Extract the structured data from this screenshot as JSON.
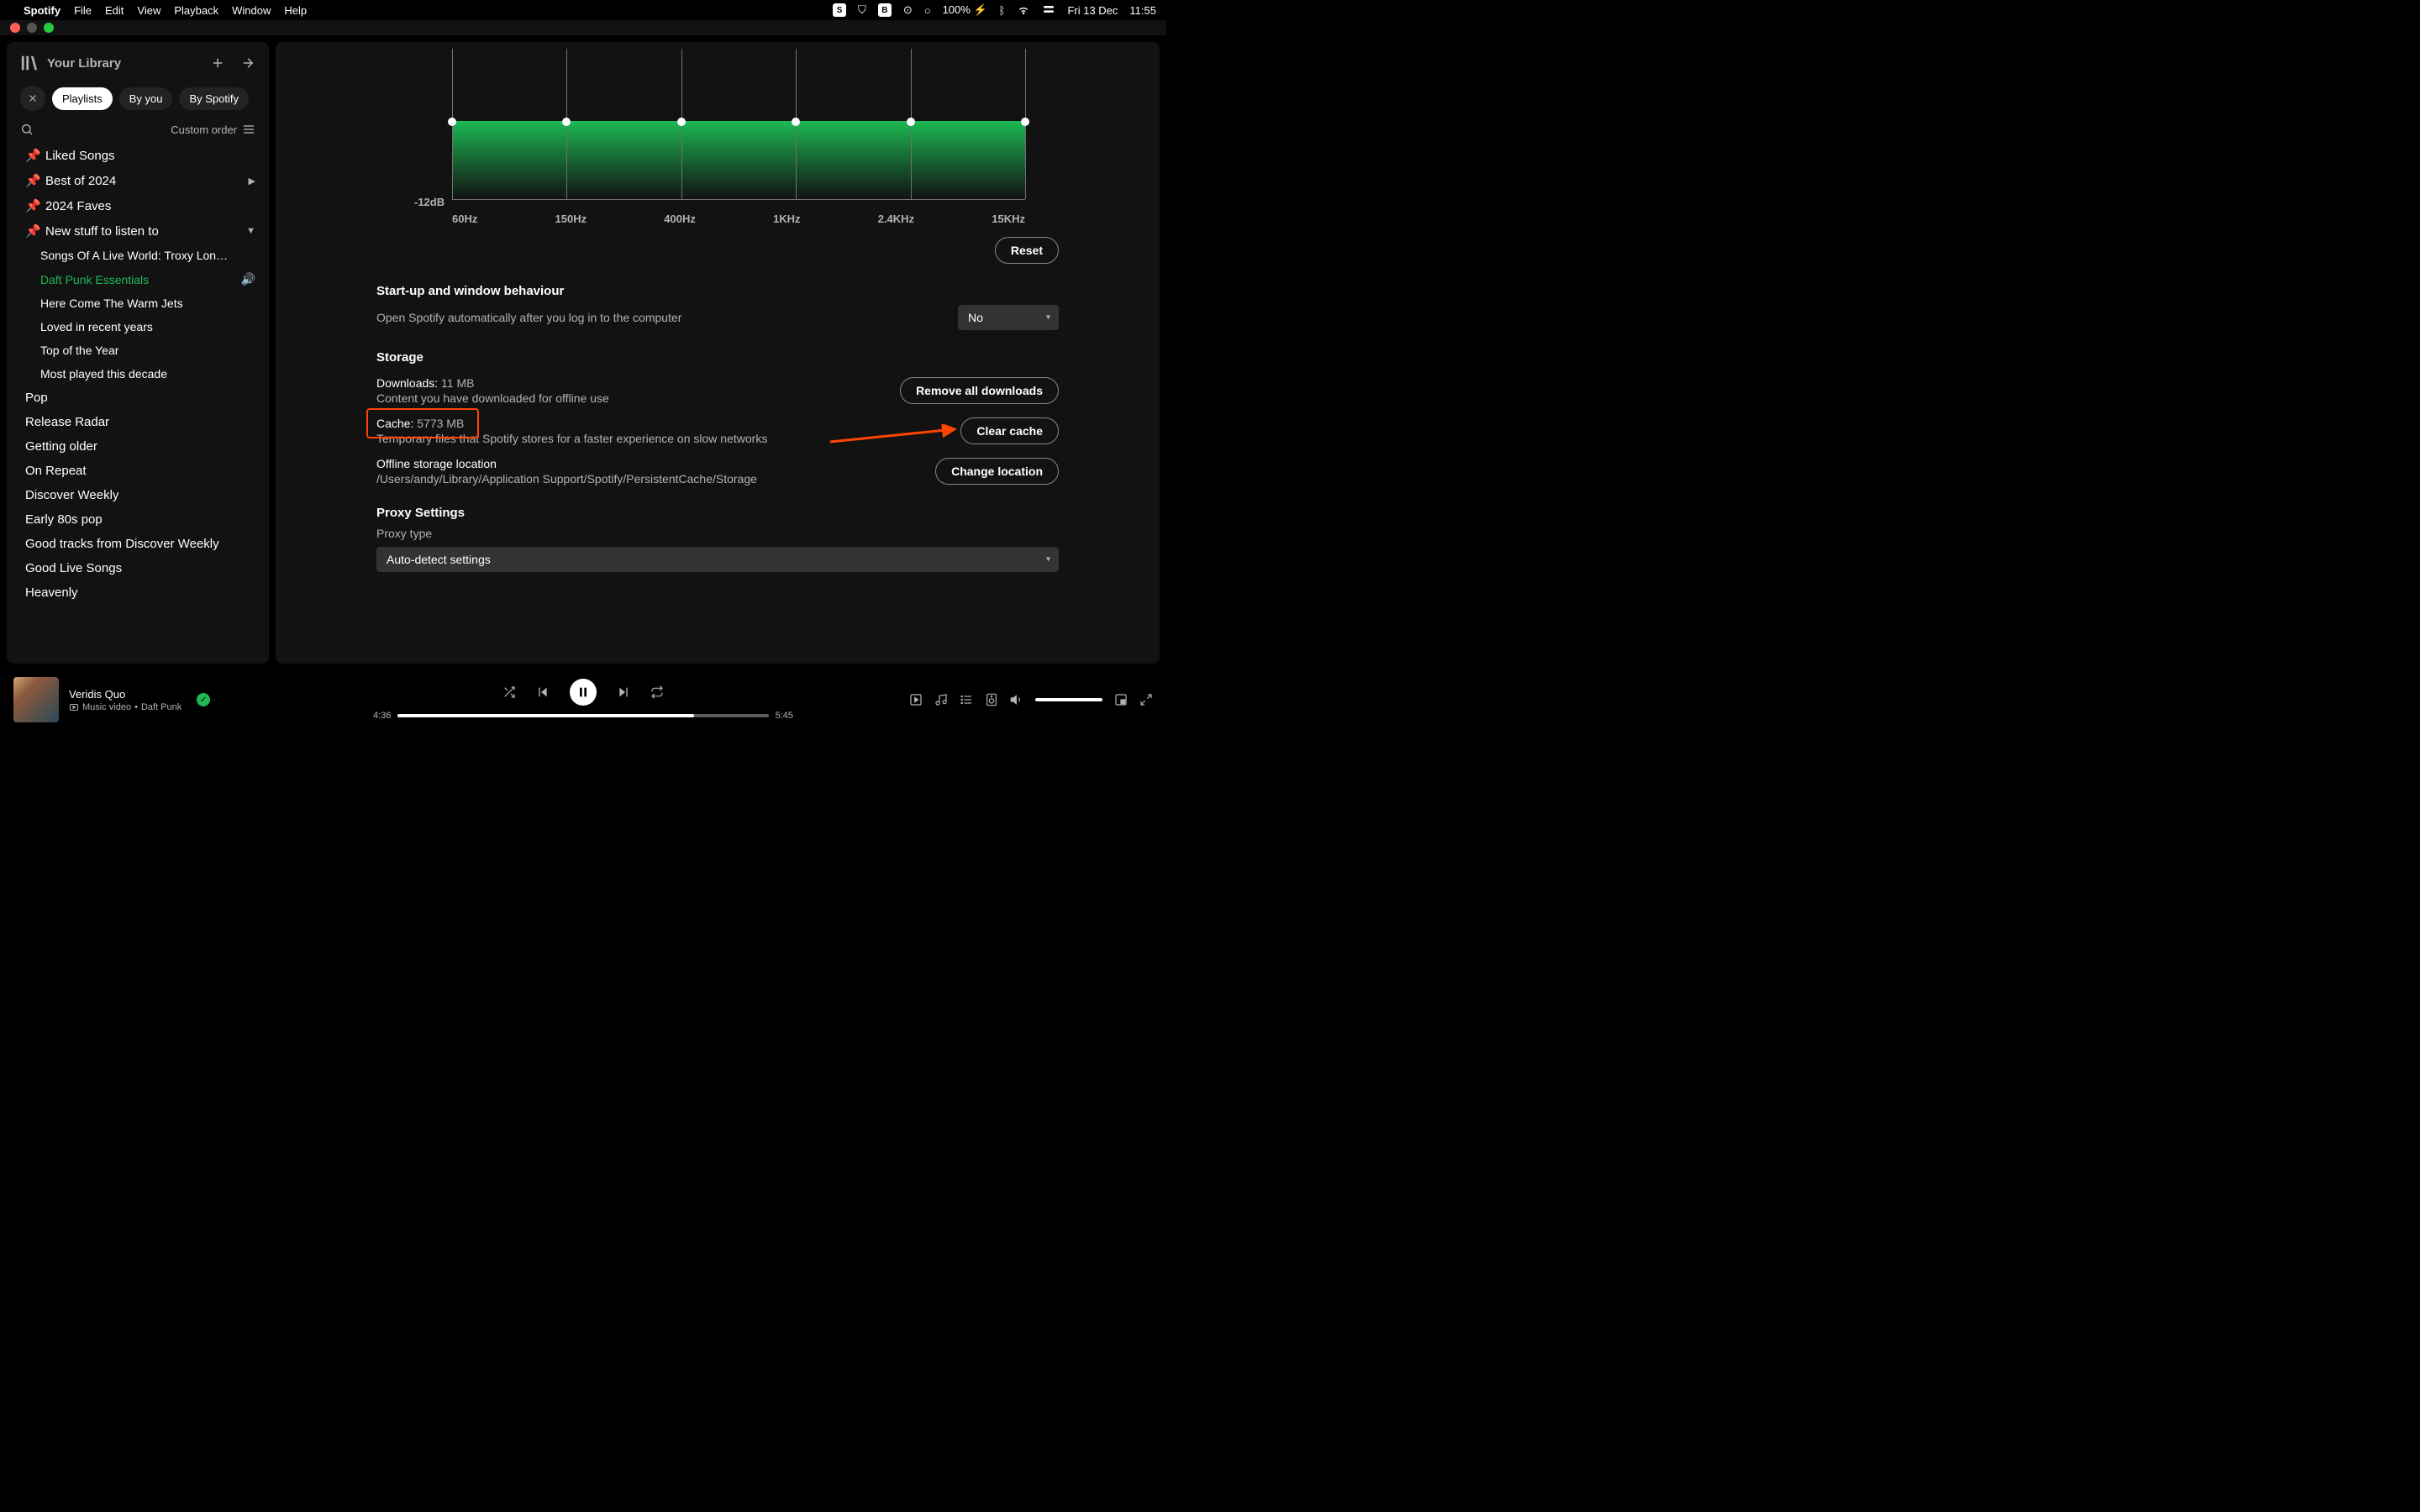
{
  "menubar": {
    "app": "Spotify",
    "items": [
      "File",
      "Edit",
      "View",
      "Playback",
      "Window",
      "Help"
    ],
    "battery": "100%",
    "date": "Fri 13 Dec",
    "time": "11:55"
  },
  "sidebar": {
    "title": "Your Library",
    "chips": {
      "active": "Playlists",
      "others": [
        "By you",
        "By Spotify"
      ]
    },
    "sort": "Custom order",
    "pinned": [
      {
        "label": "Liked Songs",
        "chev": false
      },
      {
        "label": "Best of 2024",
        "chev": true
      },
      {
        "label": "2024 Faves",
        "chev": false
      },
      {
        "label": "New stuff to listen to",
        "chev": true,
        "chevDown": true
      }
    ],
    "folder_items": [
      {
        "label": "Songs Of A Live World: Troxy Lon…"
      },
      {
        "label": "Daft Punk Essentials",
        "playing": true
      },
      {
        "label": "Here Come The Warm Jets"
      },
      {
        "label": "Loved in recent years"
      },
      {
        "label": "Top of the Year"
      },
      {
        "label": "Most played this decade"
      }
    ],
    "rest": [
      "Pop",
      "Release Radar",
      "Getting older",
      "On Repeat",
      "Discover Weekly",
      "Early 80s pop",
      "Good tracks from Discover Weekly",
      "Good Live Songs",
      "Heavenly"
    ]
  },
  "settings": {
    "eq": {
      "db_label": "-12dB",
      "freqs": [
        "60Hz",
        "150Hz",
        "400Hz",
        "1KHz",
        "2.4KHz",
        "15KHz"
      ],
      "reset": "Reset"
    },
    "startup": {
      "title": "Start-up and window behaviour",
      "desc": "Open Spotify automatically after you log in to the computer",
      "value": "No"
    },
    "storage": {
      "title": "Storage",
      "downloads_label": "Downloads:",
      "downloads_value": "11 MB",
      "downloads_desc": "Content you have downloaded for offline use",
      "remove_btn": "Remove all downloads",
      "cache_label": "Cache:",
      "cache_value": "5773 MB",
      "cache_desc": "Temporary files that Spotify stores for a faster experience on slow networks",
      "clear_btn": "Clear cache",
      "offline_label": "Offline storage location",
      "offline_path": "/Users/andy/Library/Application Support/Spotify/PersistentCache/Storage",
      "change_btn": "Change location"
    },
    "proxy": {
      "title": "Proxy Settings",
      "type_label": "Proxy type",
      "type_value": "Auto-detect settings"
    }
  },
  "player": {
    "track": "Veridis Quo",
    "meta_prefix": "Music video",
    "artist": "Daft Punk",
    "elapsed": "4:36",
    "total": "5:45"
  }
}
